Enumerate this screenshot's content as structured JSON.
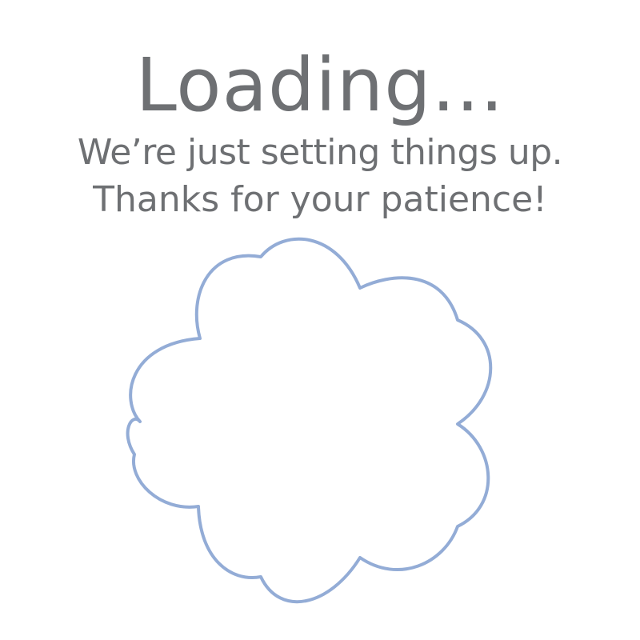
{
  "loading_screen": {
    "title": "Loading...",
    "subtitle_line1": "We’re just setting things up.",
    "subtitle_line2": "Thanks for your patience!",
    "spinner_icon": "scalloped-flower-outline-icon",
    "colors": {
      "text": "#6e7073",
      "spinner_stroke": "#93acd6",
      "background": "#ffffff"
    }
  }
}
